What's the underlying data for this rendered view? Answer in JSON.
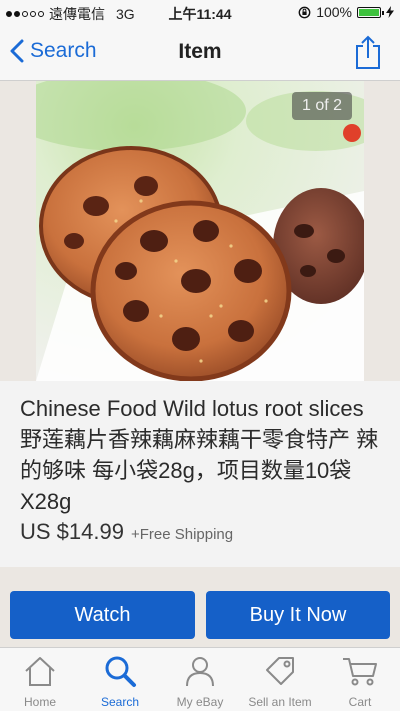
{
  "status_bar": {
    "carrier": "遠傳電信",
    "network": "3G",
    "time": "上午11:44",
    "battery": "100%"
  },
  "nav": {
    "back_label": "Search",
    "title": "Item"
  },
  "photo": {
    "counter": "1 of 2"
  },
  "item": {
    "title": "Chinese Food Wild lotus root slices 野莲藕片香辣藕麻辣藕干零食特产 辣的够味 每小袋28g，项目数量10袋X28g",
    "price": "US $14.99",
    "shipping": "+Free Shipping"
  },
  "actions": {
    "watch": "Watch",
    "buy_now": "Buy It Now"
  },
  "tabs": [
    {
      "label": "Home",
      "icon": "home-icon"
    },
    {
      "label": "Search",
      "icon": "search-icon"
    },
    {
      "label": "My eBay",
      "icon": "person-icon"
    },
    {
      "label": "Sell an Item",
      "icon": "tag-icon"
    },
    {
      "label": "Cart",
      "icon": "cart-icon"
    }
  ],
  "colors": {
    "accent": "#1b6bd6",
    "button": "#1560c8",
    "battery": "#3ec23e"
  }
}
